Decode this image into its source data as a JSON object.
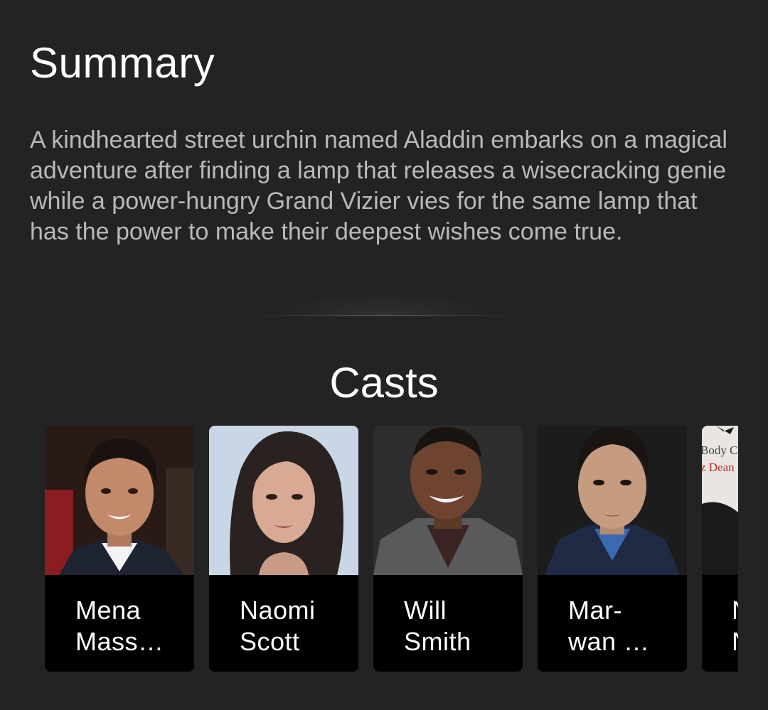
{
  "summary": {
    "title": "Summary",
    "text": "A kindhearted street urchin named Aladdin embarks on a magical adventure after finding a lamp that releases a wisecracking genie while a power-hungry Grand Vizier vies for the same lamp that has the power to make their deepest wishes come true."
  },
  "casts": {
    "title": "Casts",
    "members": [
      {
        "name_line1": "Mena",
        "name_line2": "Mass…"
      },
      {
        "name_line1": "Naomi",
        "name_line2": "Scott"
      },
      {
        "name_line1": "Will",
        "name_line2": "Smith"
      },
      {
        "name_line1": "Mar-",
        "name_line2": "wan …"
      },
      {
        "name_line1": "N",
        "name_line2": "N",
        "photo_text_1": "Body Ca",
        "photo_text_2": "z Dean"
      }
    ]
  },
  "colors": {
    "background": "#232323",
    "card": "#000000",
    "body_text": "#b9b9b9",
    "title_text": "#ffffff"
  }
}
